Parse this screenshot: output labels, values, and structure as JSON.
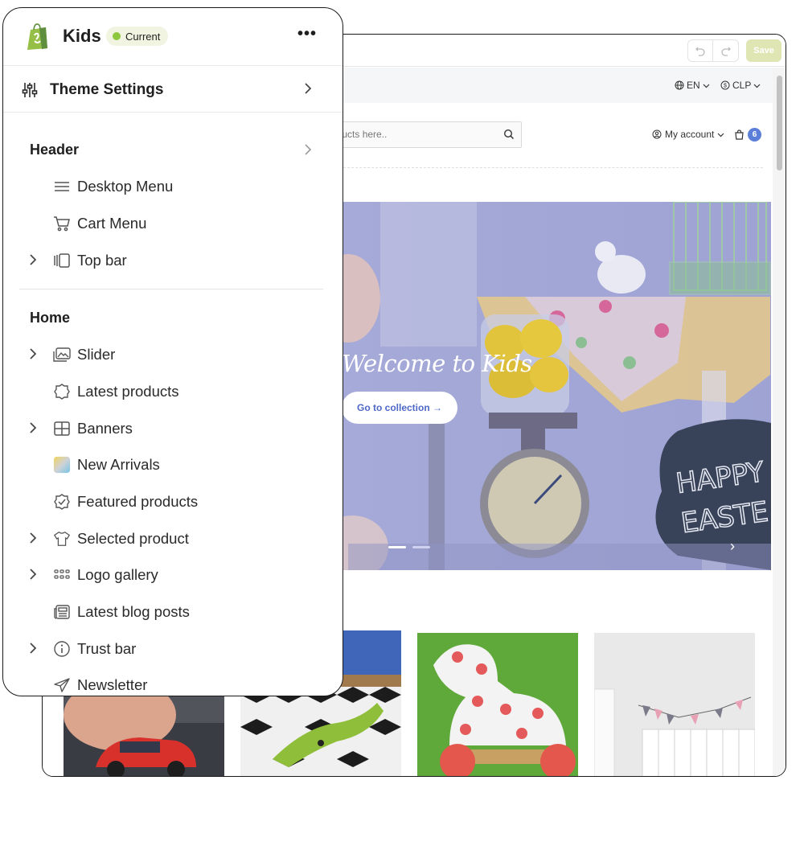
{
  "editor": {
    "save_label": "Save",
    "undo_icon": "undo-icon",
    "redo_icon": "redo-icon"
  },
  "store": {
    "language": "EN",
    "currency": "CLP",
    "search_placeholder": "r products here..",
    "account_label": "My account",
    "cart_count": "6",
    "hero": {
      "title": "Welcome to Kids",
      "cta_label": "Go to collection →",
      "chalkboard_text": "HAPPY EASTER"
    }
  },
  "sidebar": {
    "theme_name": "Kids",
    "status_badge": "Current",
    "more_label": "•••",
    "theme_settings_label": "Theme Settings",
    "sections": [
      {
        "title": "Header",
        "items": [
          {
            "label": "Desktop Menu",
            "icon": "menu-lines-icon",
            "expandable": false
          },
          {
            "label": "Cart Menu",
            "icon": "cart-icon",
            "expandable": false
          },
          {
            "label": "Top bar",
            "icon": "top-bar-icon",
            "expandable": true
          }
        ]
      },
      {
        "title": "Home",
        "items": [
          {
            "label": "Slider",
            "icon": "image-slider-icon",
            "expandable": true
          },
          {
            "label": "Latest products",
            "icon": "badge-icon",
            "expandable": false
          },
          {
            "label": "Banners",
            "icon": "grid-icon",
            "expandable": true
          },
          {
            "label": "New Arrivals",
            "icon": "gradient-thumbnail-icon",
            "expandable": false
          },
          {
            "label": "Featured products",
            "icon": "check-badge-icon",
            "expandable": false
          },
          {
            "label": "Selected product",
            "icon": "tshirt-icon",
            "expandable": true
          },
          {
            "label": "Logo gallery",
            "icon": "dots-grid-icon",
            "expandable": true
          },
          {
            "label": "Latest blog posts",
            "icon": "newspaper-icon",
            "expandable": false
          },
          {
            "label": "Trust bar",
            "icon": "info-icon",
            "expandable": true
          },
          {
            "label": "Newsletter",
            "icon": "paper-plane-icon",
            "expandable": false
          }
        ]
      }
    ]
  },
  "colors": {
    "accent_green": "#8dc63f",
    "save_button": "#dfe6b4",
    "hero_overlay": "#a6aad8",
    "cta_text": "#4e68c8",
    "cart_badge": "#5b7ed8"
  }
}
